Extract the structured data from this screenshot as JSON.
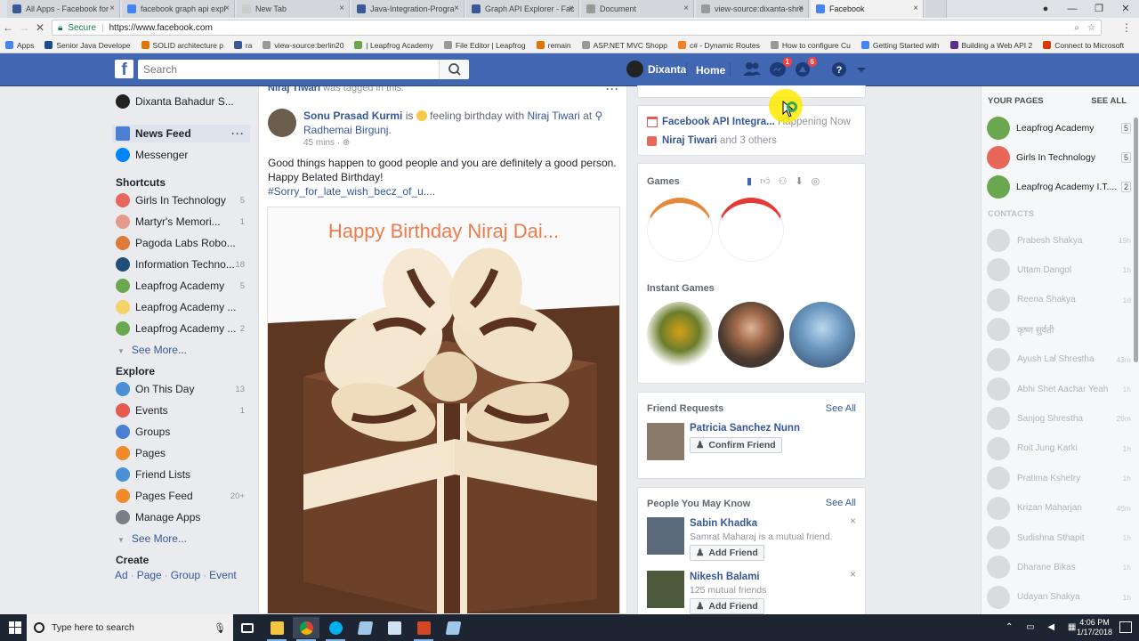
{
  "browser": {
    "tabs": [
      {
        "label": "All Apps - Facebook for",
        "color": "#3b5998"
      },
      {
        "label": "facebook graph api expl",
        "color": "#4285f4"
      },
      {
        "label": "New Tab",
        "color": "#cccccc"
      },
      {
        "label": "Java-Integration-Progra",
        "color": "#3b5998"
      },
      {
        "label": "Graph API Explorer - Fac",
        "color": "#3b5998"
      },
      {
        "label": "Document",
        "color": "#999999"
      },
      {
        "label": "view-source:dixanta-shre",
        "color": "#999999"
      },
      {
        "label": "Facebook",
        "color": "#4285f4"
      }
    ],
    "secure_label": "Secure",
    "url": "https://www.facebook.com",
    "bookmarks": [
      {
        "label": "Apps",
        "color": "#4285f4"
      },
      {
        "label": "Senior Java Develope",
        "color": "#1a4d8f"
      },
      {
        "label": "SOLID architecture p",
        "color": "#e37400"
      },
      {
        "label": "ra",
        "color": "#3b5998"
      },
      {
        "label": "view-source:berlin20",
        "color": "#999999"
      },
      {
        "label": "| Leapfrog Academy",
        "color": "#6aa84f"
      },
      {
        "label": "File Editor | Leapfrog",
        "color": "#999999"
      },
      {
        "label": "remain",
        "color": "#e37400"
      },
      {
        "label": "ASP.NET MVC Shopp",
        "color": "#999999"
      },
      {
        "label": "c# - Dynamic Routes",
        "color": "#f48024"
      },
      {
        "label": "How to configure Cu",
        "color": "#999999"
      },
      {
        "label": "Getting Started with",
        "color": "#4285f4"
      },
      {
        "label": "Building a Web API 2",
        "color": "#5c2d91"
      },
      {
        "label": "Connect to Microsoft",
        "color": "#d83b01"
      }
    ]
  },
  "fb_header": {
    "logo": "f",
    "search_placeholder": "Search",
    "user_name": "Dixanta",
    "home_label": "Home",
    "messages_badge": "1",
    "notifications_badge": "6",
    "brand_color": "#4267b2"
  },
  "left_nav": {
    "profile": "Dixanta Bahadur S...",
    "news_feed": "News Feed",
    "messenger": "Messenger",
    "shortcuts_title": "Shortcuts",
    "shortcuts": [
      {
        "label": "Girls In Technology",
        "count": "5",
        "color": "#e8675a"
      },
      {
        "label": "Martyr's Memori...",
        "count": "1",
        "color": "#e39b8c"
      },
      {
        "label": "Pagoda Labs Robo...",
        "count": "",
        "color": "#e07a3a"
      },
      {
        "label": "Information Techno...",
        "count": "18",
        "color": "#1f4e79"
      },
      {
        "label": "Leapfrog Academy",
        "count": "5",
        "color": "#6aa84f"
      },
      {
        "label": "Leapfrog Academy ...",
        "count": "",
        "color": "#f6d26b"
      },
      {
        "label": "Leapfrog Academy ...",
        "count": "2",
        "color": "#6aa84f"
      }
    ],
    "see_more": "See More...",
    "explore_title": "Explore",
    "explore": [
      {
        "label": "On This Day",
        "count": "13",
        "color": "#4a90d9"
      },
      {
        "label": "Events",
        "count": "1",
        "color": "#e55a4f"
      },
      {
        "label": "Groups",
        "count": "",
        "color": "#4a7fd4"
      },
      {
        "label": "Pages",
        "count": "",
        "color": "#f08a2c"
      },
      {
        "label": "Friend Lists",
        "count": "",
        "color": "#4a90d9"
      },
      {
        "label": "Pages Feed",
        "count": "20+",
        "color": "#f08a2c"
      },
      {
        "label": "Manage Apps",
        "count": "",
        "color": "#7a7f87"
      }
    ],
    "see_more_2": "See More...",
    "create_title": "Create",
    "create_links": [
      "Ad",
      "Page",
      "Group",
      "Event"
    ]
  },
  "post": {
    "top_line_name": "Niraj Tiwari",
    "top_line_rest": "was tagged in this.",
    "author": "Sonu Prasad Kurmi",
    "feeling": "is",
    "feeling_text": "feeling birthday with",
    "with_name": "Niraj Tiwari",
    "at": "at",
    "place": "Radhemai Birgunj",
    "time": "45 mins",
    "text_line1": "Good things happen to good people and you are definitely a good person.",
    "text_line2": "Happy Belated Birthday!",
    "hashtag": "#Sorry_for_late_wish_becz_of_u....",
    "image_caption": "Happy Birthday Niraj Dai..."
  },
  "right": {
    "event_name": "Facebook API Integra...",
    "event_status": "Happening Now",
    "birthday_name": "Niraj Tiwari",
    "birthday_rest": "and 3 others",
    "games_title": "Games",
    "instant_games_title": "Instant Games",
    "friend_requests_title": "Friend Requests",
    "see_all": "See All",
    "request_name": "Patricia Sanchez Nunn",
    "confirm_label": "Confirm Friend",
    "pymk_title": "People You May Know",
    "pymk": [
      {
        "name": "Sabin Khadka",
        "sub": "Samrat Maharaj is a mutual friend.",
        "btn": "Add Friend"
      },
      {
        "name": "Nikesh Balami",
        "sub": "125 mutual friends",
        "btn": "Add Friend"
      }
    ]
  },
  "chat": {
    "your_pages": "YOUR PAGES",
    "see_all": "SEE ALL",
    "pages": [
      {
        "label": "Leapfrog Academy",
        "count": "5",
        "color": "#6aa84f"
      },
      {
        "label": "Girls In Technology",
        "count": "5",
        "color": "#e8675a"
      },
      {
        "label": "Leapfrog Academy I.T....",
        "count": "2",
        "color": "#6aa84f"
      }
    ],
    "contacts_title": "CONTACTS",
    "contacts": [
      {
        "name": "Prabesh Shakya",
        "time": "19h"
      },
      {
        "name": "Uttam Dangol",
        "time": "1h"
      },
      {
        "name": "Reena Shakya",
        "time": "1d"
      },
      {
        "name": "कृष्ण सुर्वती",
        "time": ""
      },
      {
        "name": "Ayush Lal Shrestha",
        "time": "43m"
      },
      {
        "name": "Abhi Shet Aachar Yeah",
        "time": "1h"
      },
      {
        "name": "Sanjog Shrestha",
        "time": "26m"
      },
      {
        "name": "Roit Jung Karki",
        "time": "1h"
      },
      {
        "name": "Pratima Kshetry",
        "time": "1h"
      },
      {
        "name": "Krizan Maharjan",
        "time": "45m"
      },
      {
        "name": "Sudishna Sthapit",
        "time": "1h"
      },
      {
        "name": "Dharane Bikas",
        "time": "1h"
      },
      {
        "name": "Udayan Shakya",
        "time": "1h"
      }
    ]
  },
  "taskbar": {
    "search_placeholder": "Type here to search",
    "time": "4:06 PM",
    "date": "1/17/2018"
  }
}
